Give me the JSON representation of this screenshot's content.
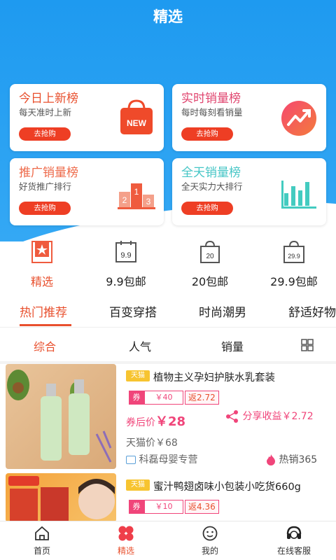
{
  "header": {
    "title": "精选"
  },
  "cards": [
    {
      "title": "今日上新榜",
      "subtitle": "每天准时上新",
      "button": "去抢购",
      "icon": "new-bag-icon",
      "title_color": "#e8502e"
    },
    {
      "title": "实时销量榜",
      "subtitle": "每时每刻看销量",
      "button": "去抢购",
      "icon": "trend-up-icon",
      "title_color": "#e0456f"
    },
    {
      "title": "推广销量榜",
      "subtitle": "好货推广排行",
      "button": "去抢购",
      "icon": "podium-icon",
      "title_color": "#ee6a4a"
    },
    {
      "title": "全天销量榜",
      "subtitle": "全天实力大排行",
      "button": "去抢购",
      "icon": "bar-chart-icon",
      "title_color": "#46c6c6"
    }
  ],
  "categories": [
    {
      "label": "精选",
      "icon": "featured-star-icon"
    },
    {
      "label": "9.9包邮",
      "icon": "calendar-9-9-icon"
    },
    {
      "label": "20包邮",
      "icon": "bag-20-icon"
    },
    {
      "label": "29.9包邮",
      "icon": "bag-29-9-icon"
    }
  ],
  "tabs": [
    "热门推荐",
    "百变穿搭",
    "时尚潮男",
    "舒适好物"
  ],
  "sort": {
    "items": [
      "综合",
      "人气",
      "销量"
    ],
    "active": "综合"
  },
  "products": [
    {
      "badge": "天猫",
      "title": "植物主义孕妇护肤水乳套装",
      "coupon_label": "券",
      "coupon_value": "￥40",
      "fanli": "返2.72",
      "after_label": "券后价",
      "after_price": "￥28",
      "share": "分享收益￥2.72",
      "tmall_price": "天猫价￥68",
      "shop": "科磊母婴专营",
      "hot": "热销365"
    },
    {
      "badge": "天猫",
      "title": "蜜汁鸭翅卤味小包装小吃货660g",
      "coupon_label": "券",
      "coupon_value": "￥10",
      "fanli": "返4.36"
    }
  ],
  "bottom_nav": [
    {
      "label": "首页",
      "icon": "home-icon"
    },
    {
      "label": "精选",
      "icon": "featured-clover-icon"
    },
    {
      "label": "我的",
      "icon": "profile-face-icon"
    },
    {
      "label": "在线客服",
      "icon": "headset-icon"
    }
  ],
  "colors": {
    "accent": "#e8502e",
    "pink": "#f0457a",
    "header_blue": "#1e9af0",
    "tmall_yellow": "#f7c430"
  }
}
